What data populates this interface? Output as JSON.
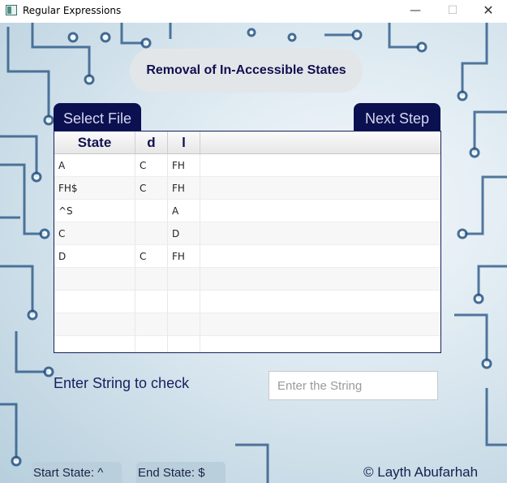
{
  "window": {
    "title": "Regular Expressions",
    "controls": {
      "minimize": "—",
      "maximize": "☐",
      "close": "✕"
    }
  },
  "heading": "Removal of In-Accessible States",
  "buttons": {
    "select_file": "Select File",
    "next_step": "Next Step"
  },
  "table": {
    "columns": [
      "State",
      "d",
      "l",
      ""
    ],
    "rows": [
      [
        "A",
        "C",
        "FH",
        ""
      ],
      [
        "FH$",
        "C",
        "FH",
        ""
      ],
      [
        "^S",
        "",
        "A",
        ""
      ],
      [
        "C",
        "",
        "D",
        ""
      ],
      [
        "D",
        "C",
        "FH",
        ""
      ],
      [
        "",
        "",
        "",
        ""
      ],
      [
        "",
        "",
        "",
        ""
      ],
      [
        "",
        "",
        "",
        ""
      ],
      [
        "",
        "",
        "",
        ""
      ]
    ]
  },
  "check": {
    "prompt": "Enter String to check",
    "placeholder": "Enter the String",
    "value": ""
  },
  "status": {
    "start_state": "Start State: ^",
    "end_state": "End State: $"
  },
  "footer": "© Layth Abufarhah"
}
